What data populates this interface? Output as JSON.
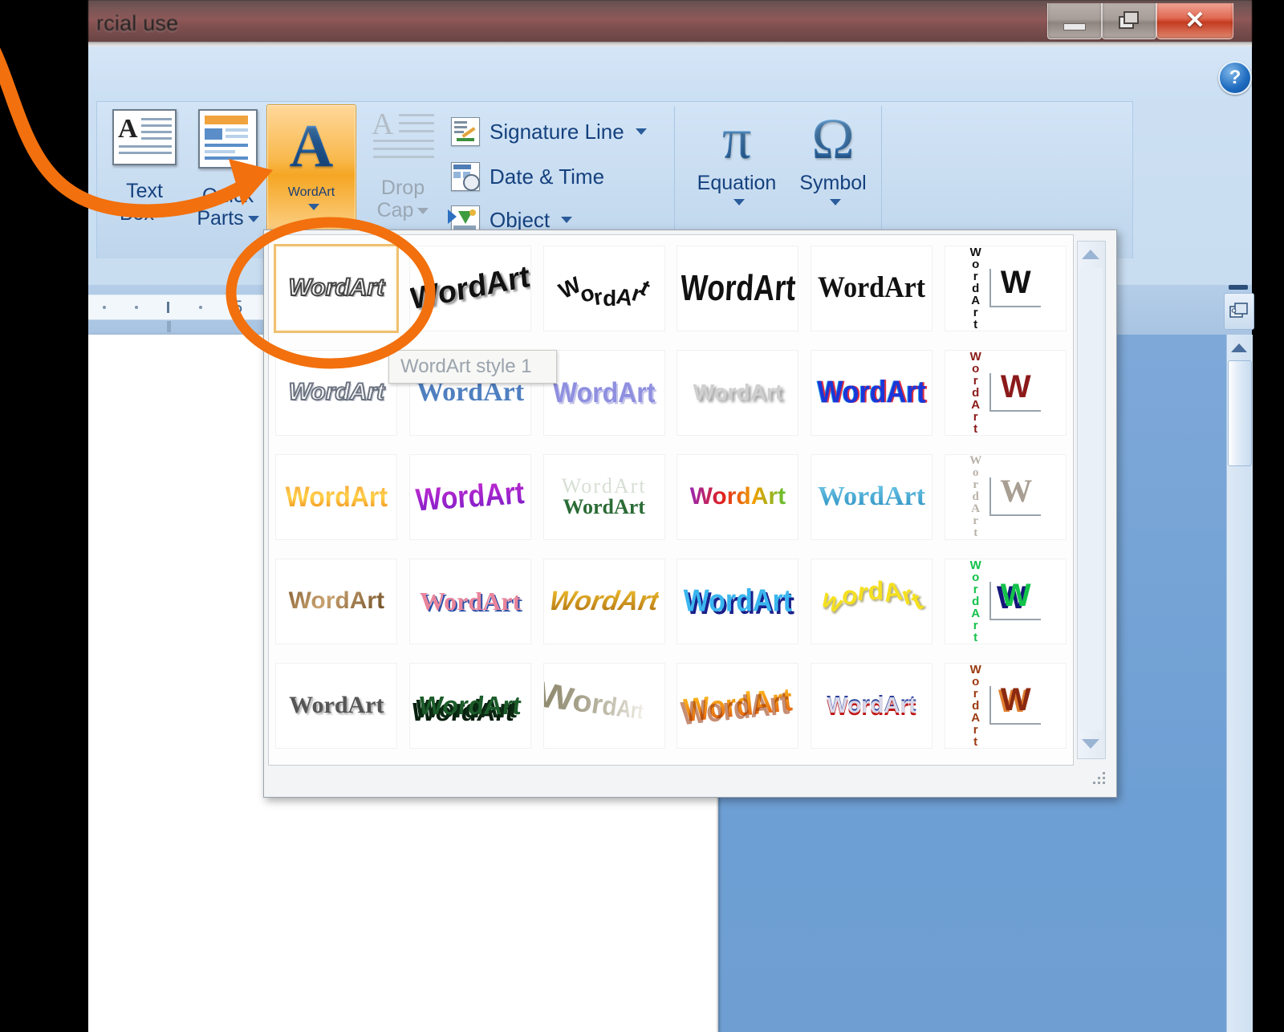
{
  "window": {
    "title": "rcial use",
    "controls": {
      "minimize": "–",
      "maximize": "❐",
      "close": "✕"
    },
    "help_label": "?"
  },
  "ribbon": {
    "buttons": [
      {
        "label_line1": "Text",
        "label_line2": "Box",
        "name": "text-box",
        "has_caret": true,
        "disabled": false
      },
      {
        "label_line1": "Quick",
        "label_line2": "Parts",
        "name": "quick-parts",
        "has_caret": true,
        "disabled": false
      },
      {
        "label_line1": "WordArt",
        "label_line2": "",
        "name": "wordart",
        "has_caret": true,
        "disabled": false,
        "active": true
      },
      {
        "label_line1": "Drop",
        "label_line2": "Cap",
        "name": "drop-cap",
        "has_caret": true,
        "disabled": true
      }
    ],
    "commands": [
      {
        "label": "Signature Line",
        "icon": "signature-line-icon",
        "has_caret": true
      },
      {
        "label": "Date & Time",
        "icon": "date-time-icon",
        "has_caret": false
      },
      {
        "label": "Object",
        "icon": "object-icon",
        "has_caret": true
      }
    ],
    "symbols": [
      {
        "glyph": "π",
        "label": "Equation",
        "name": "equation"
      },
      {
        "glyph": "Ω",
        "label": "Symbol",
        "name": "symbol"
      }
    ],
    "wordart_icon_letter": "A"
  },
  "ruler": {
    "mark_5": "5"
  },
  "tooltip": {
    "text": "WordArt style 1"
  },
  "gallery": {
    "label": "WordArt",
    "selected_index": 0,
    "rows": [
      [
        {
          "text": "WordArt",
          "style": "outline-3d",
          "name": "wordart-style-1"
        },
        {
          "text": "WordArt",
          "style": "bold-slant-up",
          "name": "wordart-style-2"
        },
        {
          "text": "WordArt",
          "style": "arch-black",
          "name": "wordart-style-3"
        },
        {
          "text": "WordArt",
          "style": "heavy-wave",
          "name": "wordart-style-4"
        },
        {
          "text": "WordArt",
          "style": "serif-black",
          "name": "wordart-style-5"
        },
        {
          "text": "WordArt",
          "style": "vertical-black",
          "letter": "W",
          "name": "wordart-style-6"
        }
      ],
      [
        {
          "text": "WordArt",
          "style": "italic-outline",
          "name": "wordart-style-7"
        },
        {
          "text": "WordArt",
          "style": "blue-serif",
          "name": "wordart-style-8"
        },
        {
          "text": "WordArt",
          "style": "periwinkle",
          "name": "wordart-style-9"
        },
        {
          "text": "WordArt",
          "style": "grey-shadow",
          "name": "wordart-style-10"
        },
        {
          "text": "WordArt",
          "style": "blue-block",
          "name": "wordart-style-11"
        },
        {
          "text": "WordArt",
          "style": "vertical-maroon",
          "letter": "W",
          "name": "wordart-style-12"
        }
      ],
      [
        {
          "text": "WordArt",
          "style": "orange-gradient",
          "name": "wordart-style-13"
        },
        {
          "text": "WordArt",
          "style": "magenta-purple",
          "name": "wordart-style-14"
        },
        {
          "text": "WordArt",
          "style": "green-double",
          "name": "wordart-style-15"
        },
        {
          "text": "WordArt",
          "style": "rainbow",
          "name": "wordart-style-16"
        },
        {
          "text": "WordArt",
          "style": "cyan-serif",
          "name": "wordart-style-17"
        },
        {
          "text": "WordArt",
          "style": "vertical-silver",
          "letter": "W",
          "name": "wordart-style-18"
        }
      ],
      [
        {
          "text": "WordArt",
          "style": "brown-texture",
          "name": "wordart-style-19"
        },
        {
          "text": "WordArt",
          "style": "pink-blue",
          "name": "wordart-style-20"
        },
        {
          "text": "WordArt",
          "style": "gold-italic",
          "name": "wordart-style-21"
        },
        {
          "text": "WordArt",
          "style": "cyan-navy-wave",
          "name": "wordart-style-22"
        },
        {
          "text": "wordArt",
          "style": "yellow-curve",
          "name": "wordart-style-23"
        },
        {
          "text": "WordArt",
          "style": "vertical-green",
          "letter": "W",
          "name": "wordart-style-24"
        }
      ],
      [
        {
          "text": "WordArt",
          "style": "grey-3d",
          "name": "wordart-style-25"
        },
        {
          "text": "WordArt",
          "style": "green-3d-block",
          "name": "wordart-style-26"
        },
        {
          "text": "WordArt",
          "style": "perspective-fade",
          "name": "wordart-style-27"
        },
        {
          "text": "WordArt",
          "style": "orange-3d",
          "name": "wordart-style-28"
        },
        {
          "text": "WordArt",
          "style": "red-white-blue",
          "name": "wordart-style-29"
        },
        {
          "text": "WordArt",
          "style": "vertical-fire",
          "letter": "W",
          "name": "wordart-style-30"
        }
      ]
    ]
  },
  "colors": {
    "annotation": "#f2700d",
    "ribbon_text": "#15417e",
    "active_button": "#f5a623",
    "title_bar": "#8d5555",
    "page": "#ffffff",
    "workspace_blue": "#6e9fd4"
  }
}
